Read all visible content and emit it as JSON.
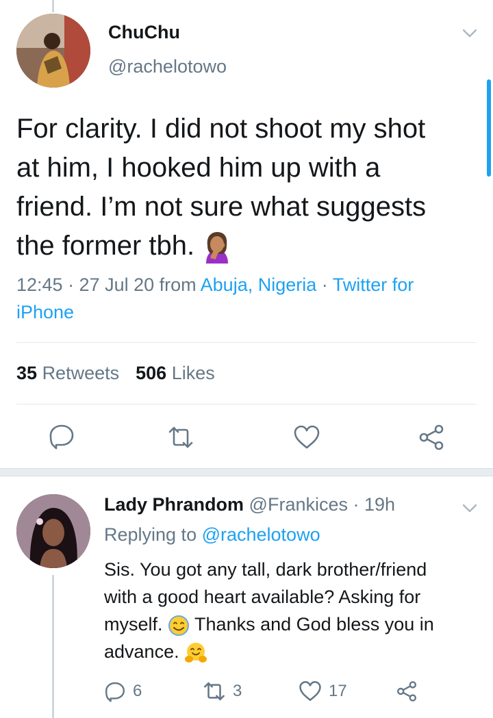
{
  "tweet": {
    "author_name": "ChuChu",
    "author_handle": "@rachelotowo",
    "text_line1": "For clarity. I did not shoot my shot",
    "text_line2": "at him, I hooked him up with a",
    "text_line3": "friend. I’m not sure what suggests",
    "text_line4": "the former tbh.",
    "time": "12:45 · 27 Jul 20 from ",
    "location": "Abuja, Nigeria",
    "source_sep": " · ",
    "source": "Twitter for iPhone",
    "retweets_count": "35",
    "retweets_label": "Retweets",
    "likes_count": "506",
    "likes_label": "Likes",
    "emoji": "woman-facepalming-emoji"
  },
  "reply": {
    "author_name": "Lady Phrandom",
    "author_handle": "@Frankices",
    "time_ago": " · 19h",
    "replying_prefix": "Replying to ",
    "replying_handle": "@rachelotowo",
    "text_line1": "Sis. You got any tall, dark brother/friend",
    "text_line2": "with a good heart available? Asking for",
    "text_line3_a": "myself.",
    "text_line3_b": "Thanks and God bless you in",
    "text_line4": "advance.",
    "reply_count": "6",
    "retweet_count": "3",
    "like_count": "17"
  },
  "colors": {
    "accent": "#1da1f2",
    "secondary_text": "#657786",
    "primary_text": "#14171a",
    "divider": "#e1e8ed"
  },
  "icons": [
    "chevron-down-icon",
    "reply-icon",
    "retweet-icon",
    "like-icon",
    "share-icon"
  ]
}
